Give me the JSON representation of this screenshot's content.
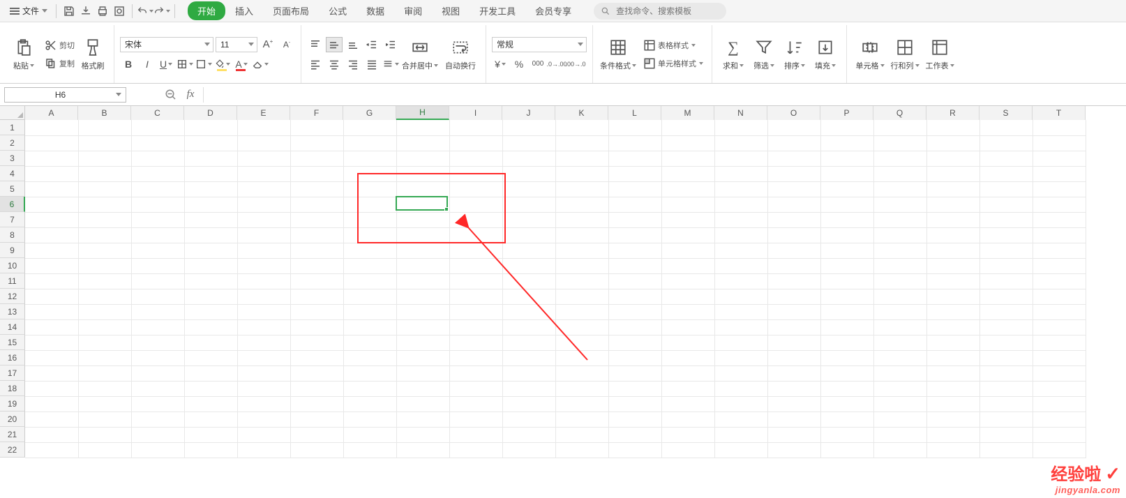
{
  "topbar": {
    "file_label": "文件",
    "tabs": [
      "开始",
      "插入",
      "页面布局",
      "公式",
      "数据",
      "审阅",
      "视图",
      "开发工具",
      "会员专享"
    ],
    "active_tab": 0,
    "search_placeholder": "查找命令、搜索模板"
  },
  "ribbon": {
    "paste_label": "粘贴",
    "cut_label": "剪切",
    "copy_label": "复制",
    "format_painter_label": "格式刷",
    "font_name": "宋体",
    "font_size": "11",
    "merge_center_label": "合并居中",
    "wrap_text_label": "自动换行",
    "number_format": "常规",
    "cond_fmt_label": "条件格式",
    "table_style_label": "表格样式",
    "cell_style_label": "单元格样式",
    "sum_label": "求和",
    "filter_label": "筛选",
    "sort_label": "排序",
    "fill_label": "填充",
    "cells_label": "单元格",
    "rowcol_label": "行和列",
    "sheet_label": "工作表"
  },
  "formula_bar": {
    "name_box": "H6",
    "formula": ""
  },
  "grid": {
    "columns": [
      "A",
      "B",
      "C",
      "D",
      "E",
      "F",
      "G",
      "H",
      "I",
      "J",
      "K",
      "L",
      "M",
      "N",
      "O",
      "P",
      "Q",
      "R",
      "S",
      "T"
    ],
    "rows": [
      "1",
      "2",
      "3",
      "4",
      "5",
      "6",
      "7",
      "8",
      "9",
      "10",
      "11",
      "12",
      "13",
      "14",
      "15",
      "16",
      "17",
      "18",
      "19",
      "20",
      "21",
      "22"
    ],
    "active_col": "H",
    "active_row": "6",
    "selected_cell": "H6"
  },
  "watermark": {
    "brand": "经验啦",
    "url": "jingyanla.com"
  }
}
